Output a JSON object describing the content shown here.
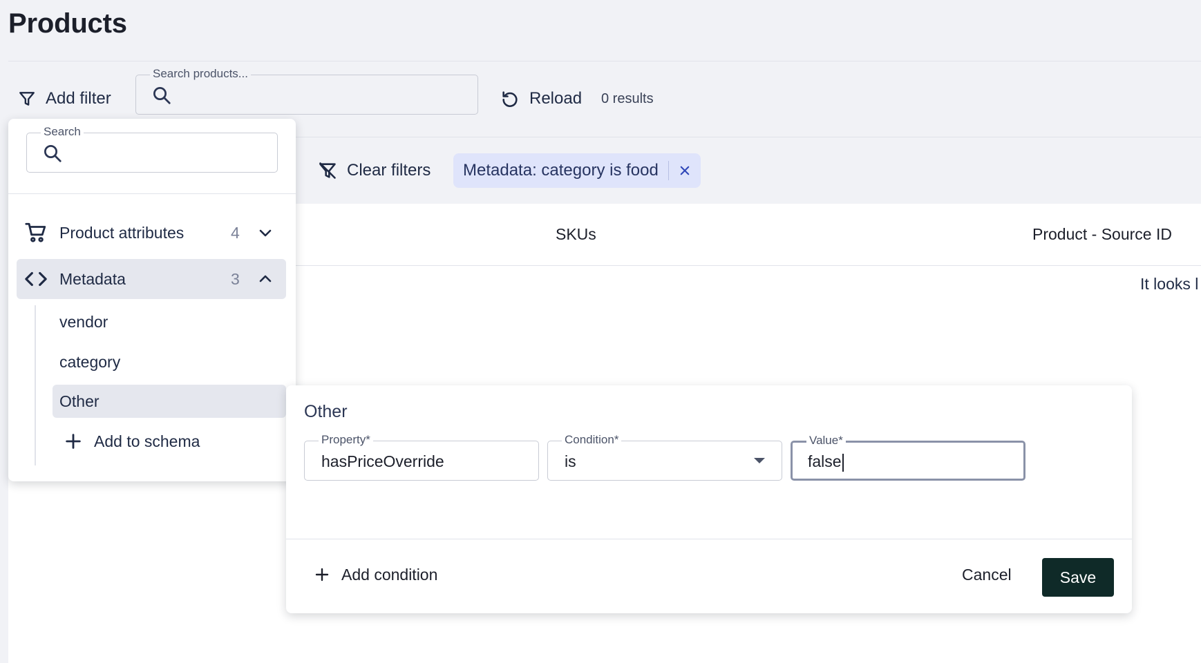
{
  "page": {
    "title": "Products"
  },
  "toolbar": {
    "add_filter_label": "Add filter",
    "search_legend": "Search products...",
    "search_value": "",
    "reload_label": "Reload",
    "results_text": "0 results"
  },
  "filters": {
    "clear_label": "Clear filters",
    "active_chip": "Metadata: category is food"
  },
  "table": {
    "columns": [
      "SKUs",
      "Product - Source ID"
    ],
    "empty_message": "It looks l"
  },
  "filter_panel": {
    "search_legend": "Search",
    "search_value": "",
    "groups": [
      {
        "label": "Product attributes",
        "count": "4",
        "icon": "shopping-cart-icon",
        "expanded": false
      },
      {
        "label": "Metadata",
        "count": "3",
        "icon": "code-icon",
        "expanded": true
      }
    ],
    "metadata_items": [
      "vendor",
      "category",
      "Other"
    ],
    "add_to_schema_label": "Add to schema"
  },
  "condition_editor": {
    "title": "Other",
    "property_legend": "Property*",
    "property_value": "hasPriceOverride",
    "condition_legend": "Condition*",
    "condition_value": "is",
    "value_legend": "Value*",
    "value_value": "false",
    "add_condition_label": "Add condition",
    "cancel_label": "Cancel",
    "save_label": "Save"
  },
  "colors": {
    "background": "#f1f2f6",
    "chip_bg": "#dfe4fb",
    "save_button": "#0f2a28",
    "selected_item": "#e5e7ee"
  }
}
